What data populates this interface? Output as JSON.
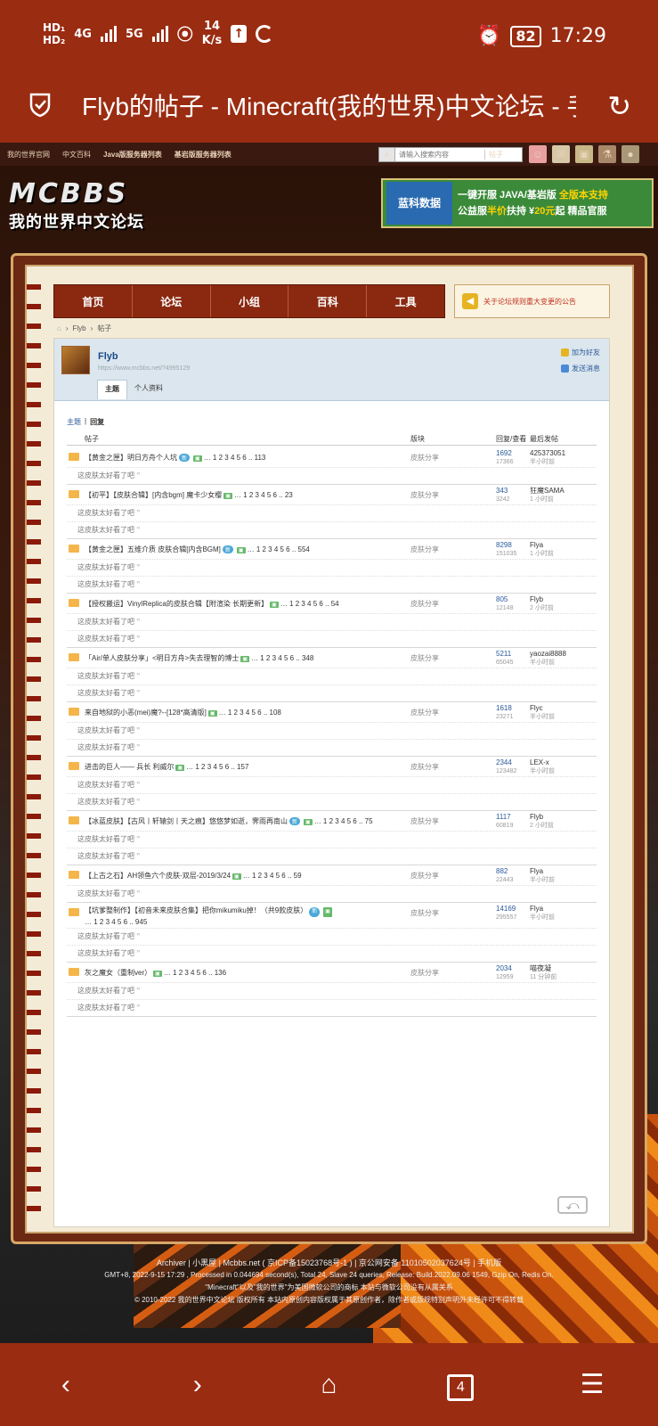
{
  "status": {
    "hd1": "HD₁",
    "hd2": "HD₂",
    "net1": "4G",
    "net2": "5G",
    "speed_val": "14",
    "speed_unit": "K/s",
    "battery": "82",
    "time": "17:29"
  },
  "browser": {
    "title": "Flyb的帖子 - Minecraft(我的世界)中文论坛 - 手机版 - Powered by Discuz!"
  },
  "topnav": {
    "items": [
      "我的世界官网",
      "中文百科",
      "Java版服务器列表",
      "基岩版服务器列表"
    ],
    "search_placeholder": "请输入搜索内容",
    "search_type": "帖子"
  },
  "logo": {
    "line1": "MCBBS",
    "line2": "我的世界中文论坛"
  },
  "ad": {
    "brand": "蓝科数据",
    "line1a": "一键开服 JAVA/基岩版 ",
    "line1b": "全版本支持",
    "line2a": "公益服",
    "line2b": "半价",
    "line2c": "扶持 ¥",
    "line2d": "20元",
    "line2e": "起 精品官服"
  },
  "nav": {
    "items": [
      "首页",
      "论坛",
      "小组",
      "百科",
      "工具"
    ],
    "notice": "关于论坛规则重大变更的公告"
  },
  "crumb": {
    "home": "⌂",
    "items": [
      "Flyb",
      "帖子"
    ]
  },
  "profile": {
    "name": "Flyb",
    "url": "https://www.mcbbs.net/?4995129",
    "add_friend": "加为好友",
    "send_msg": "发送消息",
    "tabs": [
      "主题",
      "个人资料"
    ]
  },
  "list": {
    "subtabs": [
      "主题",
      "回复"
    ],
    "headers": {
      "post": "帖子",
      "board": "版块",
      "stats": "回复/查看",
      "last": "最后发帖"
    },
    "sub_text": "这皮肤太好看了吧",
    "rows": [
      {
        "title": "【黄金之匣】明日方舟个人坑",
        "badge": "新",
        "pages": "1 2 3 4 5 6 .. 113",
        "board": "皮肤分享",
        "replies": "1692",
        "views": "17366",
        "last_user": "425373051",
        "last_time": "半小时前",
        "subs": 1
      },
      {
        "title": "【初平】【皮肤合辑】[内含bgm] 魔卡少女樱",
        "badge": "",
        "pages": "1 2 3 4 5 6 .. 23",
        "board": "皮肤分享",
        "replies": "343",
        "views": "3242",
        "last_user": "狂魔SAMA",
        "last_time": "1 小时前",
        "subs": 2
      },
      {
        "title": "【黄金之匣】五维介质 皮肤合辑[内含BGM]",
        "badge": "新",
        "pages": "1 2 3 4 5 6 .. 554",
        "board": "皮肤分享",
        "replies": "8298",
        "views": "151035",
        "last_user": "Flya",
        "last_time": "1 小时前",
        "subs": 2
      },
      {
        "title": "【授权搬运】VinylReplica的皮肤合辑【附渲染 长期更新】",
        "badge": "",
        "pages": "1 2 3 4 5 6 .. 54",
        "board": "皮肤分享",
        "replies": "805",
        "views": "12148",
        "last_user": "Flyb",
        "last_time": "2 小时前",
        "subs": 2
      },
      {
        "title": "「Air/单人皮肤分享」<明日方舟>失去理智的博士",
        "badge": "",
        "pages": "1 2 3 4 5 6 .. 348",
        "board": "皮肤分享",
        "replies": "5211",
        "views": "65045",
        "last_user": "yaozai8888",
        "last_time": "半小时前",
        "subs": 2
      },
      {
        "title": "来自地狱的小恶(mei)魔?--[128*高清版]",
        "badge": "",
        "pages": "1 2 3 4 5 6 .. 108",
        "board": "皮肤分享",
        "replies": "1618",
        "views": "23271",
        "last_user": "Flyc",
        "last_time": "半小时前",
        "subs": 2
      },
      {
        "title": "进击的巨人—— 兵长 利威尔",
        "badge": "",
        "pages": "1 2 3 4 5 6 .. 157",
        "board": "皮肤分享",
        "replies": "2344",
        "views": "123482",
        "last_user": "LEX-x",
        "last_time": "半小时前",
        "subs": 2
      },
      {
        "title": "【冰蓝皮肤】【古风丨轩辕剑丨天之痕】悠悠梦如逝，霁雨再南山",
        "badge": "新",
        "pages": "1 2 3 4 5 6 .. 75",
        "board": "皮肤分享",
        "replies": "1117",
        "views": "60819",
        "last_user": "Flyb",
        "last_time": "2 小时前",
        "subs": 2
      },
      {
        "title": "【上古之石】AH领鱼六个皮肤-双层-2019/3/24",
        "badge": "",
        "pages": "1 2 3 4 5 6 .. 59",
        "board": "皮肤分享",
        "replies": "882",
        "views": "22443",
        "last_user": "Flya",
        "last_time": "半小时前",
        "subs": 1
      },
      {
        "title": "【坑爹整制作】【初音未来皮肤合集】把你mikumiku掉！（共9款皮肤）",
        "badge": "新",
        "pages": "1 2 3 4 5 6 .. 945",
        "board": "皮肤分享",
        "replies": "14169",
        "views": "295557",
        "last_user": "Flya",
        "last_time": "半小时前",
        "subs": 2,
        "two": true
      },
      {
        "title": "灰之魔女（重制ver）",
        "badge": "",
        "pages": "1 2 3 4 5 6 .. 136",
        "board": "皮肤分享",
        "replies": "2034",
        "views": "12959",
        "last_user": "喵夜凝",
        "last_time": "11 分钟前",
        "subs": 2
      }
    ]
  },
  "footer": {
    "l1": "Archiver | 小黑屋 | Mcbbs.net ( 京ICP备15023768号-1 ) | 京公网安备 11010502037624号 | 手机版",
    "l2": "GMT+8, 2022-9-15 17:29 , Processed in 0.044694 second(s), Total 24, Slave 24 queries, Release: Build.2022.09.06 1549, Gzip On, Redis On.",
    "l3": "\"Minecraft\"以及\"我的世界\"为美国微软公司的商标 本站与微软公司没有从属关系",
    "l4": "© 2010-2022 我的世界中文论坛 版权所有 本站内原创内容版权属于其原创作者，除作者或版规特别声明外未经许可不得转载"
  },
  "bottomnav": {
    "back": "‹",
    "forward": "›",
    "home": "⌂",
    "tabs": "4",
    "menu": "☰"
  }
}
